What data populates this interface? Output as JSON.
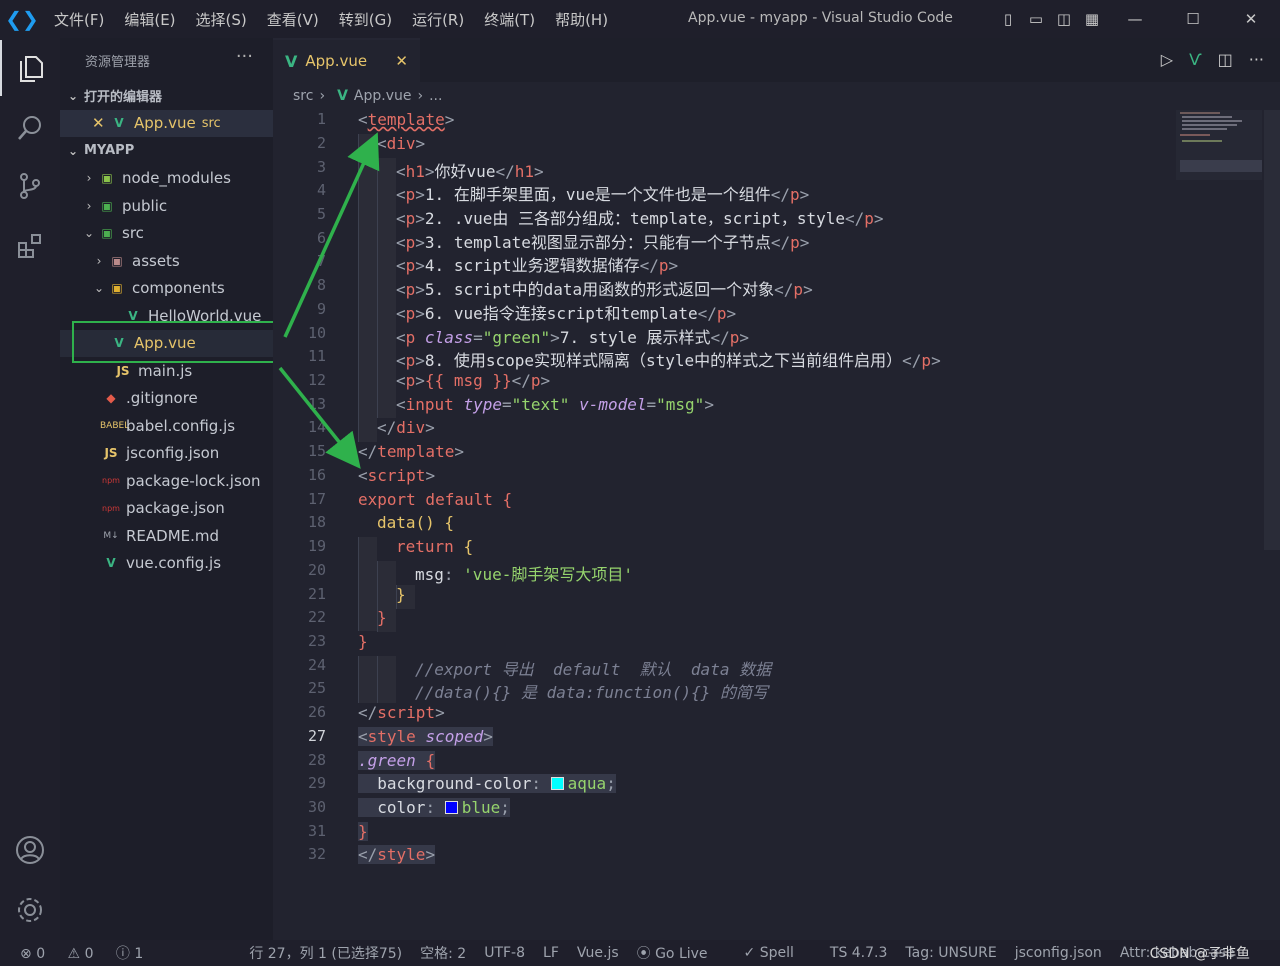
{
  "titlebar": {
    "menus": [
      "文件(F)",
      "编辑(E)",
      "选择(S)",
      "查看(V)",
      "转到(G)",
      "运行(R)",
      "终端(T)",
      "帮助(H)"
    ],
    "window_title": "App.vue - myapp - Visual Studio Code"
  },
  "sidebar": {
    "title": "资源管理器",
    "open_editors": "打开的编辑器",
    "open_file": "App.vue",
    "open_file_dir": "src",
    "project": "MYAPP",
    "tree": {
      "node_modules": "node_modules",
      "public": "public",
      "src": "src",
      "assets": "assets",
      "components": "components",
      "helloworld": "HelloWorld.vue",
      "app": "App.vue",
      "main": "main.js",
      "gitignore": ".gitignore",
      "babel": "babel.config.js",
      "jsconfig": "jsconfig.json",
      "packagelock": "package-lock.json",
      "package": "package.json",
      "readme": "README.md",
      "vueconfig": "vue.config.js"
    }
  },
  "editor": {
    "tab": "App.vue",
    "breadcrumb": {
      "folder": "src",
      "file": "App.vue",
      "more": "..."
    }
  },
  "code": {
    "l1": "template",
    "l2": "div",
    "l3": "你好vue",
    "l4": "1. 在脚手架里面，vue是一个文件也是一个组件",
    "l5": "2. .vue由 三各部分组成：template，script，style",
    "l6": "3. template视图显示部分：只能有一个子节点",
    "l7": "4. script业务逻辑数据储存",
    "l8": "5. script中的data用函数的形式返回一个对象",
    "l9": "6. vue指令连接script和template",
    "l10a": "class",
    "l10b": "\"green\"",
    "l10c": "7. style 展示样式",
    "l11": "8. 使用scope实现样式隔离（style中的样式之下当前组件启用）",
    "l12": "{{ msg }}",
    "l13a": "type",
    "l13b": "\"text\"",
    "l13c": "v-model",
    "l13d": "\"msg\"",
    "l17a": "export default",
    "l18": "data",
    "l19": "return",
    "l20a": "msg",
    "l20b": "'vue-脚手架写大项目'",
    "l24": "//export 导出  default  默认  data 数据",
    "l25": "//data(){} 是 data:function(){} 的简写",
    "l27a": "style",
    "l27b": "scoped",
    "l28": ".green",
    "l29a": "background-color",
    "l29b": "aqua",
    "l30a": "color",
    "l30b": "blue"
  },
  "colors": {
    "aqua": "#00ffff",
    "blue": "#0000ff"
  },
  "status": {
    "errors": "0",
    "warnings": "0",
    "info": "1",
    "position": "行 27，列 1 (已选择75)",
    "spaces": "空格: 2",
    "encoding": "UTF-8",
    "eol": "LF",
    "language": "Vue.js",
    "golive": "Go Live",
    "spell": "Spell",
    "ts": "TS 4.7.3",
    "tag": "Tag: UNSURE",
    "jsconfig": "jsconfig.json",
    "attr": "Attr: kebab-case",
    "watermark": "CSDN @子非鱼"
  }
}
